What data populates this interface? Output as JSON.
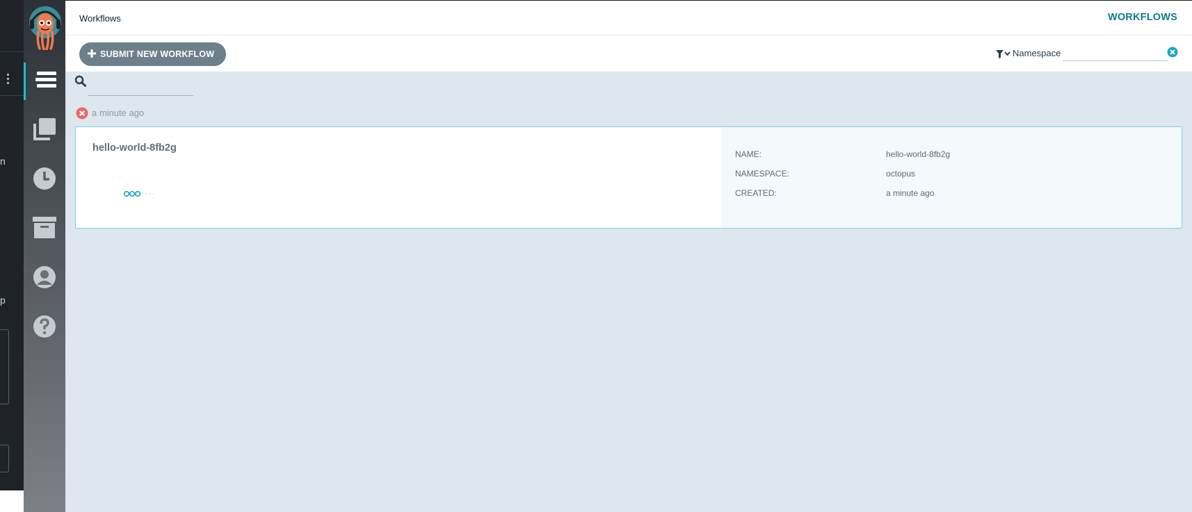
{
  "header": {
    "title": "Workflows",
    "active_tab": "WORKFLOWS"
  },
  "sidebar": {
    "items": [
      {
        "icon": "workflows-icon",
        "active": true
      },
      {
        "icon": "templates-icon",
        "active": false
      },
      {
        "icon": "cron-workflows-icon",
        "active": false
      },
      {
        "icon": "archived-workflows-icon",
        "active": false
      },
      {
        "icon": "user-icon",
        "active": false
      },
      {
        "icon": "help-icon",
        "active": false
      }
    ]
  },
  "edge_pane": {
    "fragments": [
      "n",
      "p"
    ]
  },
  "toolbar": {
    "submit_label": "SUBMIT NEW WORKFLOW",
    "namespace_label": "Namespace",
    "namespace_value": ""
  },
  "search": {
    "placeholder": "",
    "value": ""
  },
  "workflow": {
    "status": "failed",
    "time_ago": "a minute ago",
    "name": "hello-world-8fb2g",
    "details": [
      {
        "label": "NAME:",
        "value": "hello-world-8fb2g"
      },
      {
        "label": "NAMESPACE:",
        "value": "octopus"
      },
      {
        "label": "CREATED:",
        "value": "a minute ago"
      }
    ]
  },
  "colors": {
    "accent": "#0e7b8f",
    "sidebar_active": "#18bed8",
    "button": "#6d7f8b",
    "error": "#e9686b",
    "card_border": "#7fd0dc",
    "background": "#dee6ee"
  }
}
